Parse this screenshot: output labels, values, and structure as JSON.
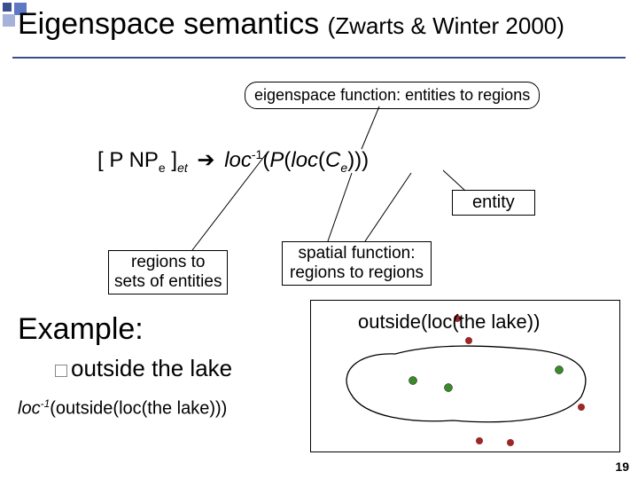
{
  "title": {
    "main": "Eigenspace semantics ",
    "sub": "(Zwarts & Winter 2000)"
  },
  "bubble_top": "eigenspace function: entities to regions",
  "equation": {
    "lhs_open": "[ P NP",
    "lhs_sub1": "e",
    "lhs_close": " ]",
    "lhs_sub2": "et",
    "arrow": "➔",
    "rhs1": "loc",
    "rhs_sup": "-1",
    "rhs2": "(",
    "rhs3": "P",
    "rhs4": "(",
    "rhs5": "loc",
    "rhs6": "(",
    "rhs7": "C",
    "rhs7sub": "e",
    "rhs8": ")))"
  },
  "entity_label": "entity",
  "regions_box": {
    "l1": "regions to",
    "l2": "sets of entities"
  },
  "spatial_box": {
    "l1": "spatial function:",
    "l2": "regions to regions"
  },
  "example_heading": "Example:",
  "example_item": "outside the lake",
  "loc_expr": {
    "a": "loc",
    "sup": "-1",
    "b": "(outside(loc(the lake)))"
  },
  "lake_caption": "outside(loc(the lake))",
  "page": "19"
}
